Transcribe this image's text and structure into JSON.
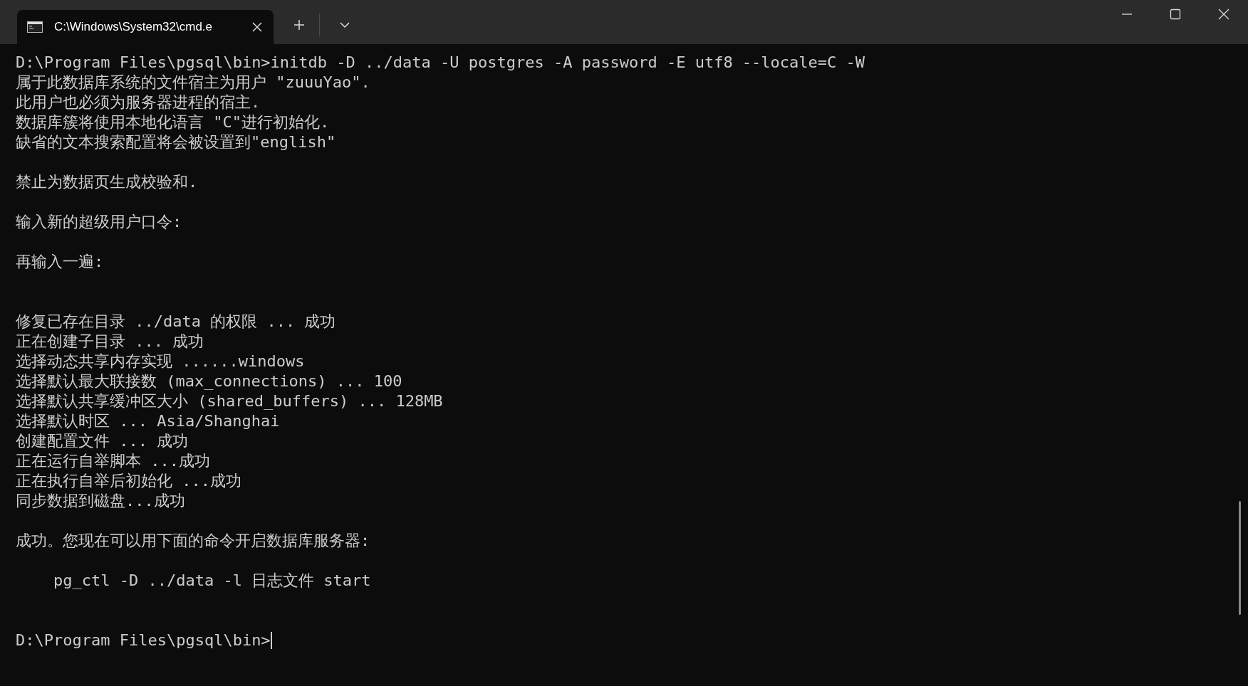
{
  "window": {
    "tab_title": "C:\\Windows\\System32\\cmd.e"
  },
  "terminal": {
    "lines": [
      {
        "kind": "output",
        "text": "D:\\Program Files\\pgsql\\bin>initdb -D ../data -U postgres -A password -E utf8 --locale=C -W"
      },
      {
        "kind": "output",
        "text": "属于此数据库系统的文件宿主为用户 \"zuuuYao\"."
      },
      {
        "kind": "output",
        "text": "此用户也必须为服务器进程的宿主."
      },
      {
        "kind": "output",
        "text": "数据库簇将使用本地化语言 \"C\"进行初始化."
      },
      {
        "kind": "output",
        "text": "缺省的文本搜索配置将会被设置到\"english\""
      },
      {
        "kind": "blank"
      },
      {
        "kind": "output",
        "text": "禁止为数据页生成校验和."
      },
      {
        "kind": "blank"
      },
      {
        "kind": "output",
        "text": "输入新的超级用户口令:"
      },
      {
        "kind": "blank"
      },
      {
        "kind": "output",
        "text": "再输入一遍:"
      },
      {
        "kind": "blank"
      },
      {
        "kind": "blank"
      },
      {
        "kind": "output",
        "text": "修复已存在目录 ../data 的权限 ... 成功"
      },
      {
        "kind": "output",
        "text": "正在创建子目录 ... 成功"
      },
      {
        "kind": "output",
        "text": "选择动态共享内存实现 ......windows"
      },
      {
        "kind": "output",
        "text": "选择默认最大联接数 (max_connections) ... 100"
      },
      {
        "kind": "output",
        "text": "选择默认共享缓冲区大小 (shared_buffers) ... 128MB"
      },
      {
        "kind": "output",
        "text": "选择默认时区 ... Asia/Shanghai"
      },
      {
        "kind": "output",
        "text": "创建配置文件 ... 成功"
      },
      {
        "kind": "output",
        "text": "正在运行自举脚本 ...成功"
      },
      {
        "kind": "output",
        "text": "正在执行自举后初始化 ...成功"
      },
      {
        "kind": "output",
        "text": "同步数据到磁盘...成功"
      },
      {
        "kind": "blank"
      },
      {
        "kind": "output",
        "text": "成功。您现在可以用下面的命令开启数据库服务器:"
      },
      {
        "kind": "blank"
      },
      {
        "kind": "output",
        "text": "    pg_ctl -D ../data -l 日志文件 start"
      },
      {
        "kind": "blank"
      },
      {
        "kind": "blank"
      },
      {
        "kind": "prompt",
        "text": "D:\\Program Files\\pgsql\\bin>"
      }
    ]
  }
}
